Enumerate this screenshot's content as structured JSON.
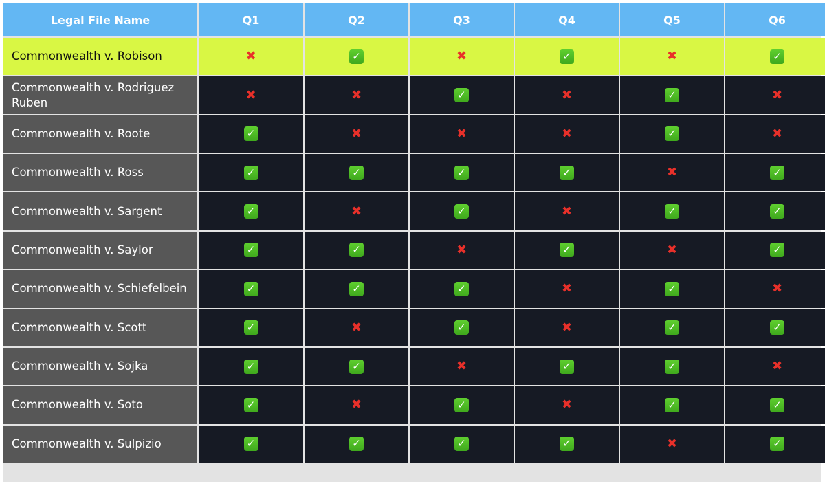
{
  "table": {
    "headers": [
      "Legal File Name",
      "Q1",
      "Q2",
      "Q3",
      "Q4",
      "Q5",
      "Q6"
    ],
    "highlighted_row": 0,
    "highlight_color": "#d9f744",
    "header_color": "#63b7f3",
    "check_color": "#4cbb22",
    "cross_color": "#e8302a",
    "rows": [
      {
        "name": "Commonwealth v. Robison",
        "results": [
          false,
          true,
          false,
          true,
          false,
          true
        ]
      },
      {
        "name": "Commonwealth v. Rodriguez Ruben",
        "results": [
          false,
          false,
          true,
          false,
          true,
          false
        ]
      },
      {
        "name": "Commonwealth v. Roote",
        "results": [
          true,
          false,
          false,
          false,
          true,
          false
        ]
      },
      {
        "name": "Commonwealth v. Ross",
        "results": [
          true,
          true,
          true,
          true,
          false,
          true
        ]
      },
      {
        "name": "Commonwealth v. Sargent",
        "results": [
          true,
          false,
          true,
          false,
          true,
          true
        ]
      },
      {
        "name": "Commonwealth v. Saylor",
        "results": [
          true,
          true,
          false,
          true,
          false,
          true
        ]
      },
      {
        "name": "Commonwealth v. Schiefelbein",
        "results": [
          true,
          true,
          true,
          false,
          true,
          false
        ]
      },
      {
        "name": "Commonwealth v. Scott",
        "results": [
          true,
          false,
          true,
          false,
          true,
          true
        ]
      },
      {
        "name": "Commonwealth v. Sojka",
        "results": [
          true,
          true,
          false,
          true,
          true,
          false
        ]
      },
      {
        "name": "Commonwealth v. Soto",
        "results": [
          true,
          false,
          true,
          false,
          true,
          true
        ]
      },
      {
        "name": "Commonwealth v. Sulpizio",
        "results": [
          true,
          true,
          true,
          true,
          false,
          true
        ]
      }
    ]
  }
}
